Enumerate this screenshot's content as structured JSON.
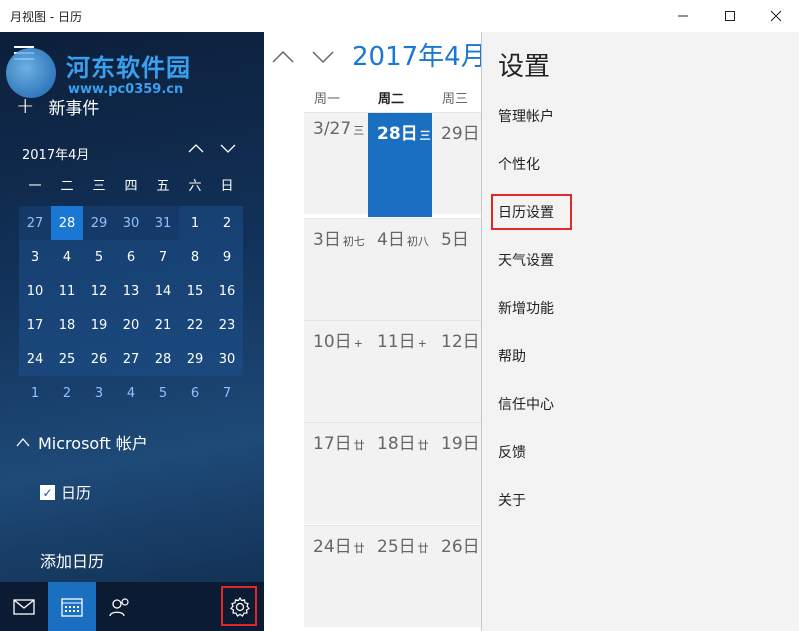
{
  "window": {
    "title": "月视图 - 日历"
  },
  "watermark": {
    "text": "河东软件园",
    "url": "www.pc0359.cn"
  },
  "sidebar": {
    "new_event": "新事件",
    "mini_cal": {
      "month": "2017年4月",
      "weekdays": [
        "一",
        "二",
        "三",
        "四",
        "五",
        "六",
        "日"
      ],
      "weeks": [
        [
          "27",
          "28",
          "29",
          "30",
          "31",
          "1",
          "2"
        ],
        [
          "3",
          "4",
          "5",
          "6",
          "7",
          "8",
          "9"
        ],
        [
          "10",
          "11",
          "12",
          "13",
          "14",
          "15",
          "16"
        ],
        [
          "17",
          "18",
          "19",
          "20",
          "21",
          "22",
          "23"
        ],
        [
          "24",
          "25",
          "26",
          "27",
          "28",
          "29",
          "30"
        ],
        [
          "1",
          "2",
          "3",
          "4",
          "5",
          "6",
          "7"
        ]
      ]
    },
    "account": "Microsoft 帐户",
    "calendar_item": "日历",
    "add_calendar": "添加日历"
  },
  "main": {
    "month_title": "2017年4月",
    "day_names": [
      "周一",
      "周二",
      "周三"
    ],
    "weeks": [
      [
        {
          "d": "3/27",
          "l": "三"
        },
        {
          "d": "28日",
          "l": "三"
        },
        {
          "d": "29日",
          "l": ""
        }
      ],
      [
        {
          "d": "3日",
          "l": "初七"
        },
        {
          "d": "4日",
          "l": "初八"
        },
        {
          "d": "5日",
          "l": ""
        }
      ],
      [
        {
          "d": "10日",
          "l": "+"
        },
        {
          "d": "11日",
          "l": "+"
        },
        {
          "d": "12日",
          "l": ""
        }
      ],
      [
        {
          "d": "17日",
          "l": "廿"
        },
        {
          "d": "18日",
          "l": "廿"
        },
        {
          "d": "19日",
          "l": ""
        }
      ],
      [
        {
          "d": "24日",
          "l": "廿"
        },
        {
          "d": "25日",
          "l": "廿"
        },
        {
          "d": "26日",
          "l": ""
        }
      ]
    ]
  },
  "settings": {
    "title": "设置",
    "items": [
      "管理帐户",
      "个性化",
      "日历设置",
      "天气设置",
      "新增功能",
      "帮助",
      "信任中心",
      "反馈",
      "关于"
    ]
  },
  "colors": {
    "accent": "#1a78d4",
    "highlight": "#e02828"
  }
}
